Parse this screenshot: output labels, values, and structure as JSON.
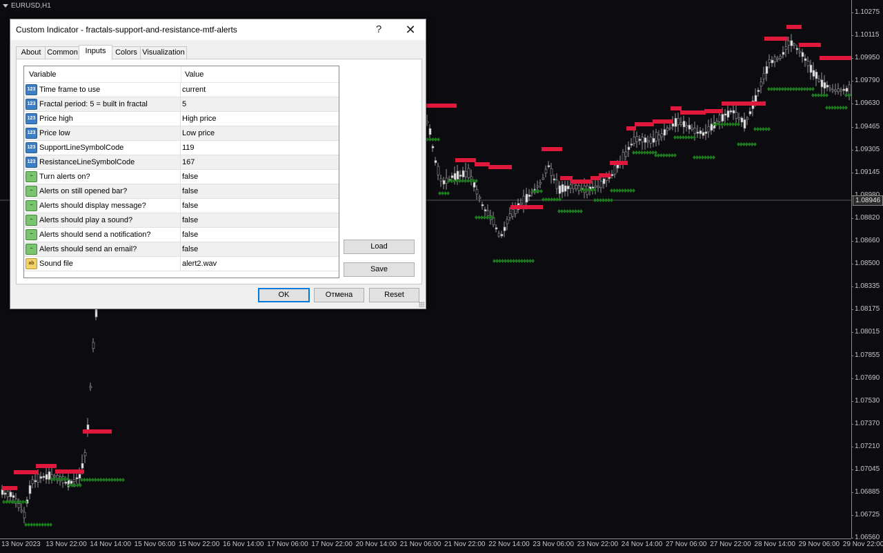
{
  "chart": {
    "symbol": "EURUSD,H1",
    "current_price": "1.08946",
    "price_labels": [
      "1.10275",
      "1.10115",
      "1.09950",
      "1.09790",
      "1.09630",
      "1.09465",
      "1.09305",
      "1.09145",
      "1.08980",
      "1.08820",
      "1.08660",
      "1.08500",
      "1.08335",
      "1.08175",
      "1.08015",
      "1.07855",
      "1.07690",
      "1.07530",
      "1.07370",
      "1.07210",
      "1.07045",
      "1.06885",
      "1.06725",
      "1.06560"
    ],
    "time_labels": [
      "13 Nov 2023",
      "13 Nov 22:00",
      "14 Nov 14:00",
      "15 Nov 06:00",
      "15 Nov 22:00",
      "16 Nov 14:00",
      "17 Nov 06:00",
      "17 Nov 22:00",
      "20 Nov 14:00",
      "21 Nov 06:00",
      "21 Nov 22:00",
      "22 Nov 14:00",
      "23 Nov 06:00",
      "23 Nov 22:00",
      "24 Nov 14:00",
      "27 Nov 06:00",
      "27 Nov 22:00",
      "28 Nov 14:00",
      "29 Nov 06:00",
      "29 Nov 22:00"
    ],
    "colors": {
      "resistance": "#e0193c",
      "support": "#1e7a1e",
      "candle": "#9a9a9a",
      "background": "#0b0b10"
    }
  },
  "dialog": {
    "title": "Custom Indicator - fractals-support-and-resistance-mtf-alerts",
    "help_label": "?",
    "close_label": "✕",
    "tabs": [
      "About",
      "Common",
      "Inputs",
      "Colors",
      "Visualization"
    ],
    "active_tab": "Inputs",
    "columns": {
      "variable": "Variable",
      "value": "Value"
    },
    "params": [
      {
        "type": "num",
        "variable": "Time frame to use",
        "value": "current"
      },
      {
        "type": "num",
        "variable": "Fractal period: 5 = built in fractal",
        "value": "5"
      },
      {
        "type": "num",
        "variable": "Price high",
        "value": "High price"
      },
      {
        "type": "num",
        "variable": "Price low",
        "value": "Low price"
      },
      {
        "type": "num",
        "variable": "SupportLineSymbolCode",
        "value": "119"
      },
      {
        "type": "num",
        "variable": "ResistanceLineSymbolCode",
        "value": "167"
      },
      {
        "type": "bool",
        "variable": "Turn alerts on?",
        "value": "false"
      },
      {
        "type": "bool",
        "variable": "Alerts on still opened bar?",
        "value": "false"
      },
      {
        "type": "bool",
        "variable": "Alerts should display message?",
        "value": "false"
      },
      {
        "type": "bool",
        "variable": "Alerts should play a sound?",
        "value": "false"
      },
      {
        "type": "bool",
        "variable": "Alerts should send a notification?",
        "value": "false"
      },
      {
        "type": "bool",
        "variable": "Alerts should send an email?",
        "value": "false"
      },
      {
        "type": "str",
        "variable": "Sound file",
        "value": "alert2.wav"
      }
    ],
    "icon_text": {
      "num": "123",
      "bool": "~",
      "str": "ab"
    },
    "load_label": "Load",
    "save_label": "Save",
    "ok_label": "OK",
    "cancel_label": "Отмена",
    "reset_label": "Reset"
  }
}
